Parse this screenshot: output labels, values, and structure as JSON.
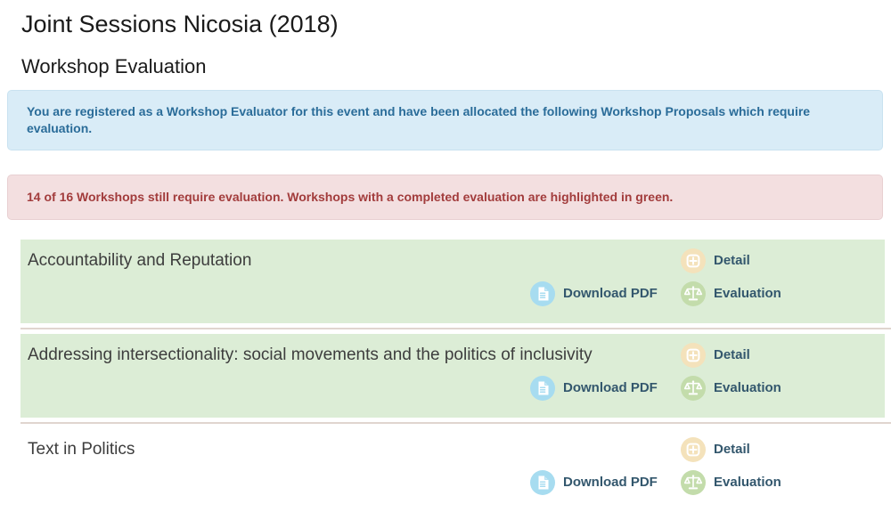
{
  "page": {
    "title": "Joint Sessions Nicosia (2018)",
    "subtitle": "Workshop Evaluation"
  },
  "alerts": {
    "info": "You are registered as a Workshop Evaluator for this event and have been allocated the following Workshop Proposals which require evaluation.",
    "danger": "14 of 16 Workshops still require evaluation. Workshops with a completed evaluation are highlighted in green."
  },
  "actions": {
    "detail_label": "Detail",
    "download_label": "Download PDF",
    "evaluation_label": "Evaluation"
  },
  "workshops": [
    {
      "title": "Accountability and Reputation",
      "evaluated": true
    },
    {
      "title": "Addressing intersectionality: social movements and the politics of inclusivity",
      "evaluated": true
    },
    {
      "title": "Text in Politics",
      "evaluated": false
    }
  ],
  "icons": {
    "detail": "plus-square-icon",
    "download": "pdf-file-icon",
    "evaluation": "scales-icon"
  },
  "colors": {
    "highlight_green": "#dcedd6",
    "info_bg": "#d9ecf7",
    "info_text": "#2a6c99",
    "danger_bg": "#f3dfe0",
    "danger_text": "#a23c3c",
    "detail_icon_bg": "#f4e2bb",
    "download_icon_bg": "#a7dcf0",
    "evaluation_icon_bg": "#c3dcab",
    "action_label": "#33576d"
  }
}
